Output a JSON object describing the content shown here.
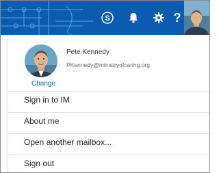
{
  "topbar": {
    "icons": [
      "skype-icon",
      "bell-icon",
      "gear-icon",
      "help-icon"
    ],
    "help_glyph": "?",
    "accent": "#0a5cb0"
  },
  "user": {
    "name": "Pete Kennedy",
    "email": "PKennedy@ministryofcaring.org",
    "change_label": "Change"
  },
  "menu": {
    "items": [
      {
        "label": "Sign in to IM"
      },
      {
        "label": "About me"
      },
      {
        "label": "Open another mailbox..."
      },
      {
        "label": "Sign out"
      }
    ]
  }
}
